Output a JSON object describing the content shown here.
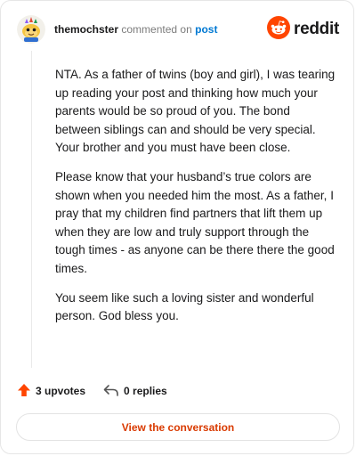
{
  "header": {
    "username": "themochster",
    "commented_text": "commented on",
    "post_link": "post",
    "brand": "reddit",
    "avatar_icon": "snoo-avatar-icon",
    "logo_icon": "reddit-snoo-icon",
    "brand_color": "#ff4500"
  },
  "comment": {
    "paragraphs": [
      "NTA. As a father of twins (boy and girl), I was tearing up reading your post and thinking how much your parents would be so proud of you. The bond between siblings can and should be very special. Your brother and you must have been close.",
      "Please know that your husband’s true colors are shown when you needed him the most. As a father, I pray that my children find partners that lift them up when they are low and truly support through the tough times - as anyone can be there there the good times.",
      "You seem like such a loving sister and wonderful person. God bless you."
    ]
  },
  "actions": {
    "upvotes_label": "3 upvotes",
    "replies_label": "0 replies",
    "upvote_color": "#ff4500"
  },
  "cta": {
    "label": "View the conversation",
    "color": "#d93a00"
  }
}
